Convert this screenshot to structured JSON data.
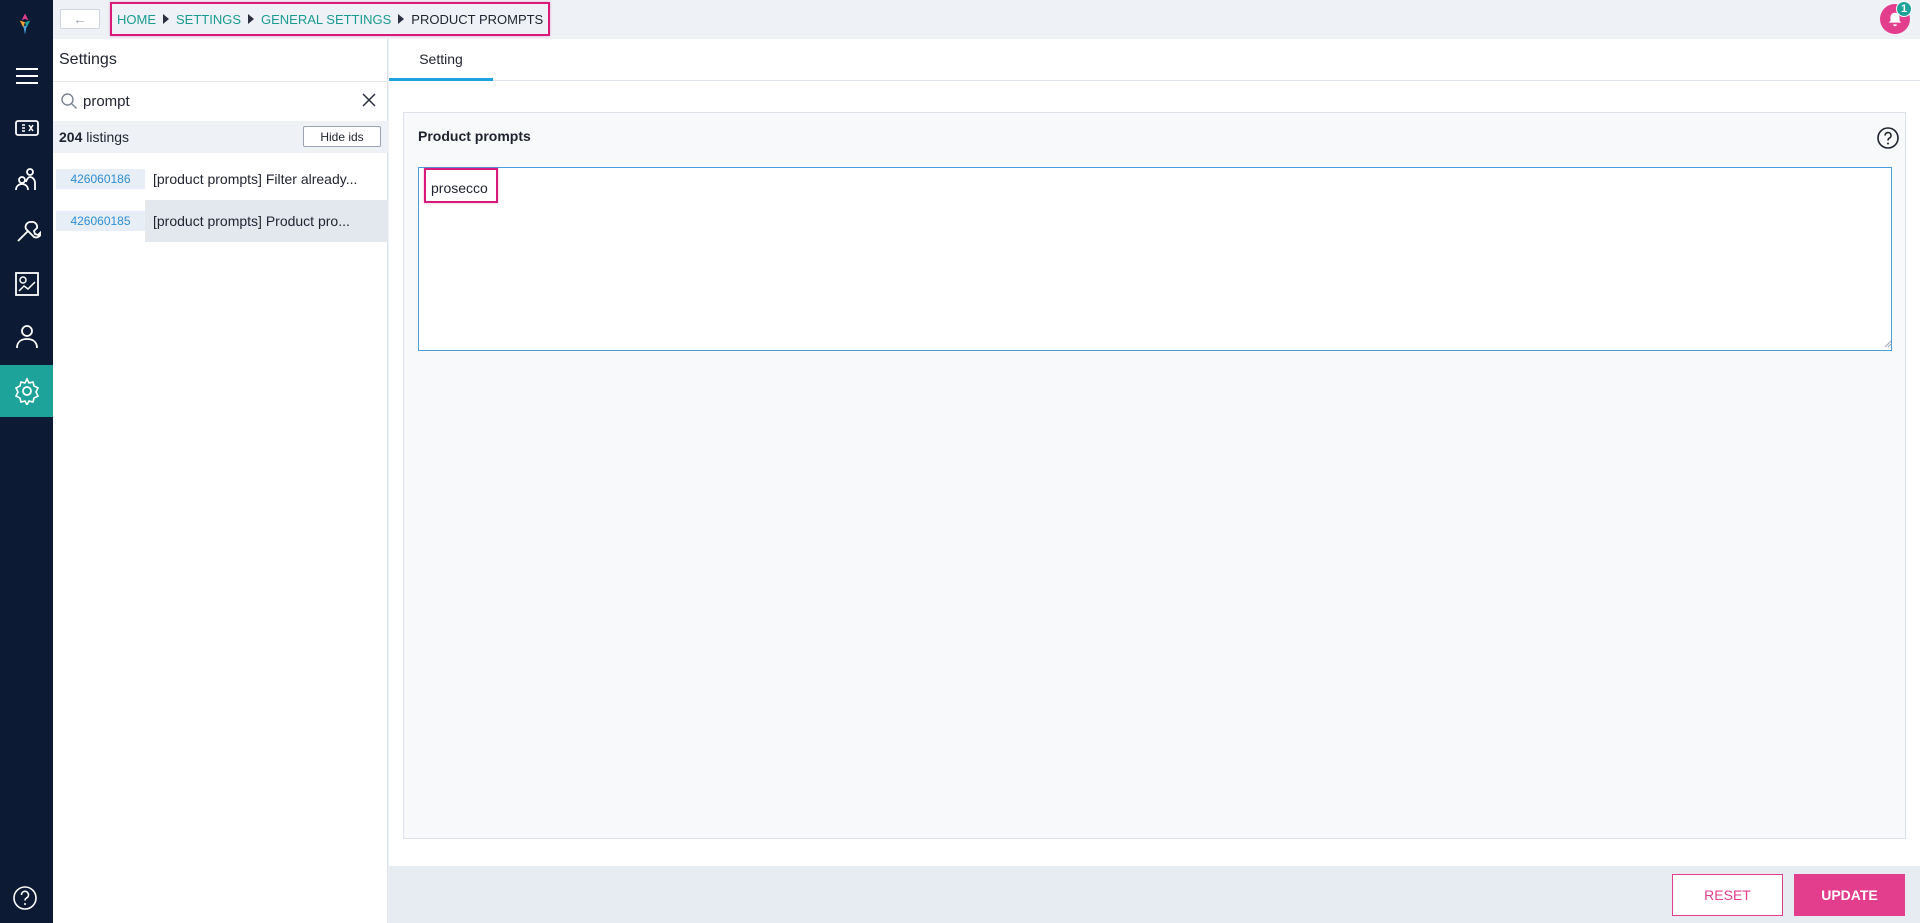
{
  "topbar": {
    "back_icon": "arrow-left-icon",
    "breadcrumb": [
      "HOME",
      "SETTINGS",
      "GENERAL SETTINGS",
      "PRODUCT PROMPTS"
    ],
    "notification_count": "1",
    "notification_icon": "bell-icon"
  },
  "nav": {
    "items": [
      "menu-icon",
      "ticket-icon",
      "customers-icon",
      "tools-icon",
      "report-icon",
      "user-icon",
      "gear-icon"
    ],
    "active": "gear-icon",
    "help_icon": "help-icon"
  },
  "settings_panel": {
    "title": "Settings",
    "search_value": "prompt",
    "listing_count": "204",
    "listing_suffix": "listings",
    "hide_ids_label": "Hide ids",
    "items": [
      {
        "id": "426060186",
        "label": "[product prompts] Filter already..."
      },
      {
        "id": "426060185",
        "label": "[product prompts] Product pro..."
      }
    ]
  },
  "main": {
    "tab_label": "Setting",
    "card_title": "Product prompts",
    "textarea_value": "prosecco"
  },
  "footer": {
    "reset_label": "RESET",
    "update_label": "UPDATE"
  },
  "colors": {
    "rail": "#0c1a33",
    "accent": "#1ea39a",
    "pink": "#e33d8e",
    "link": "#1a9b92"
  }
}
